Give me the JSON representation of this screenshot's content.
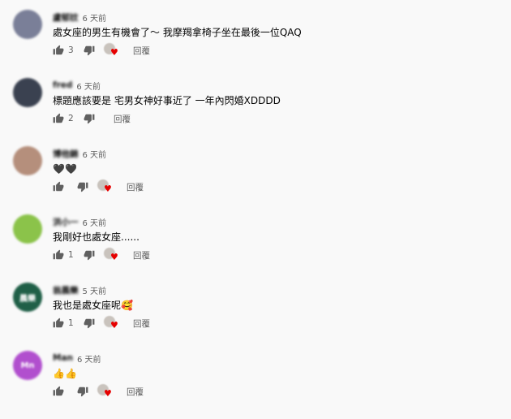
{
  "icons": {
    "like": "thumb-up-icon",
    "dislike": "thumb-down-icon",
    "heart": "creator-heart-icon"
  },
  "colors": {
    "background": "#f9f9f9",
    "meta": "#606060",
    "heart": "#e60000"
  },
  "heart_glyph": "♥",
  "comments": [
    {
      "author": "盧郁妏",
      "time": "6 天前",
      "text": "處女座的男生有機會了～ 我摩羯拿椅子坐在最後一位QAQ",
      "likes": "3",
      "hearted": true,
      "reply": "回覆",
      "avatar_color": "#7a7f98",
      "avatar_text": ""
    },
    {
      "author": "fred",
      "time": "6 天前",
      "text": "標題應該要是 宅男女神好事近了 一年內閃婚XDDDD",
      "likes": "2",
      "hearted": false,
      "reply": "回覆",
      "avatar_color": "#3a4150",
      "avatar_text": ""
    },
    {
      "author": "博他錦",
      "time": "6 天前",
      "text": "🖤🖤",
      "likes": "",
      "hearted": true,
      "reply": "回覆",
      "avatar_color": "#b58f7c",
      "avatar_text": ""
    },
    {
      "author": "洪小一",
      "time": "6 天前",
      "text": "我剛好也處女座......",
      "likes": "1",
      "hearted": true,
      "reply": "回覆",
      "avatar_color": "#8bc34a",
      "avatar_text": ""
    },
    {
      "author": "翁晨樂",
      "time": "5 天前",
      "text": "我也是處女座呢🥰",
      "likes": "1",
      "hearted": true,
      "reply": "回覆",
      "avatar_color": "#1f5f47",
      "avatar_text": "晨樂"
    },
    {
      "author": "Man",
      "time": "6 天前",
      "text": "👍👍",
      "likes": "",
      "hearted": true,
      "reply": "回覆",
      "avatar_color": "#b14fce",
      "avatar_text": "Mn"
    }
  ]
}
